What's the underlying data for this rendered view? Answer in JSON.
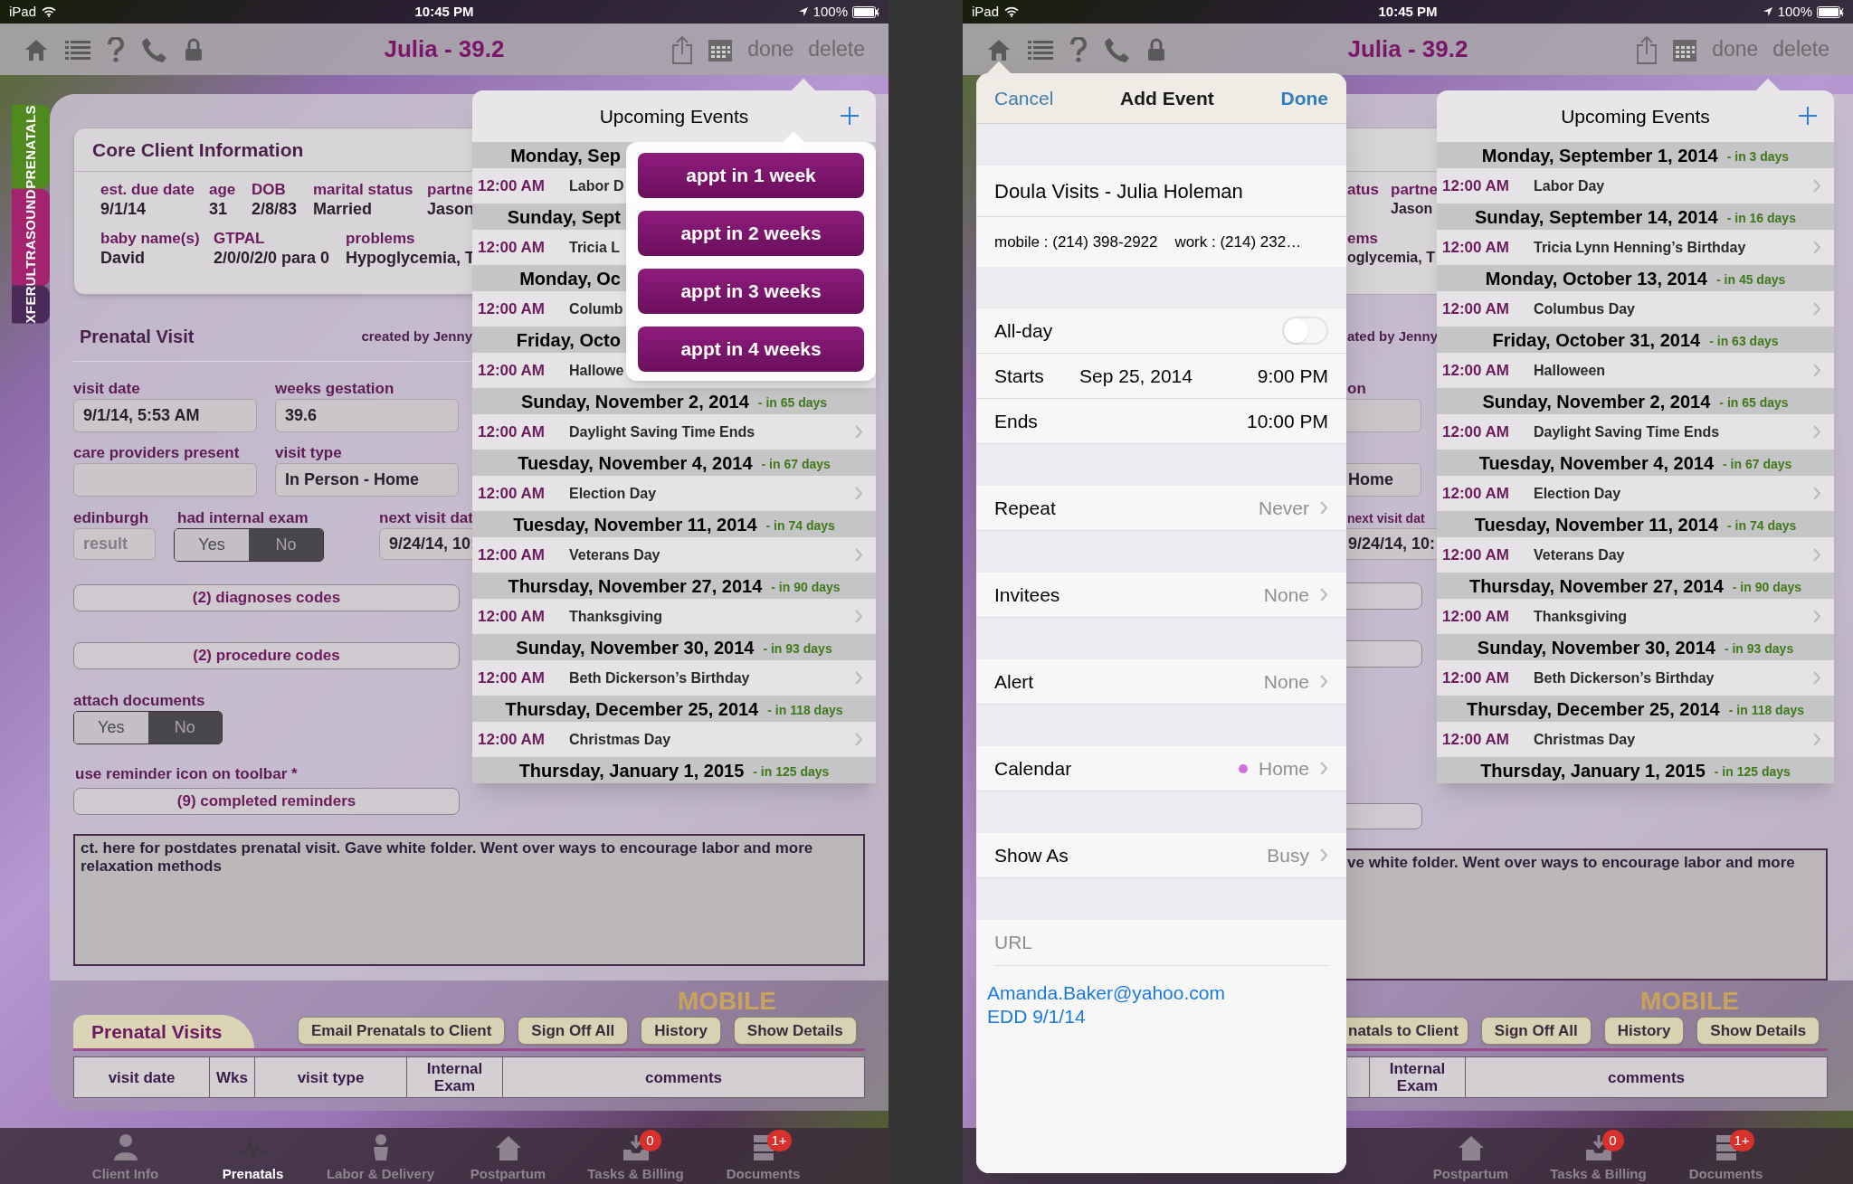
{
  "left_screen": {
    "status_bar": {
      "carrier": "iPad",
      "time": "10:45 PM",
      "battery": "100%"
    },
    "nav_bar": {
      "title": "Julia - 39.2",
      "actions": [
        "done",
        "delete"
      ]
    },
    "side_tabs": [
      {
        "label": "PRENATALS",
        "color": "#4f8a1f"
      },
      {
        "label": "ULTRASOUND",
        "color": "#a3236f"
      },
      {
        "label": "XFER",
        "color": "#4b2a5a"
      }
    ],
    "core_info": {
      "title": "Core Client Information",
      "rows": [
        {
          "fields": [
            {
              "label": "est. due date",
              "value": "9/1/14"
            },
            {
              "label": "age",
              "value": "31"
            },
            {
              "label": "DOB",
              "value": "2/8/83"
            },
            {
              "label": "marital status",
              "value": "Married"
            },
            {
              "label": "partne",
              "value": "Jason"
            }
          ]
        },
        {
          "fields": [
            {
              "label": "baby name(s)",
              "value": "David"
            },
            {
              "label": "GTPAL",
              "value": "2/0/0/2/0 para 0"
            },
            {
              "label": "problems",
              "value": "Hypoglycemia, T"
            }
          ]
        }
      ]
    },
    "prenatal_visit": {
      "title": "Prenatal Visit",
      "created_by": "created by Jenny",
      "visit_date": {
        "label": "visit date",
        "value": "9/1/14, 5:53 AM"
      },
      "weeks_gestation": {
        "label": "weeks gestation",
        "value": "39.6"
      },
      "care_providers": {
        "label": "care providers present"
      },
      "visit_type": {
        "label": "visit type",
        "value": "In Person - Home"
      },
      "edinburgh": {
        "label": "edinburgh",
        "placeholder": "result"
      },
      "internal_exam": {
        "label": "had internal exam",
        "options": [
          {
            "label": "Yes",
            "selected": false
          },
          {
            "label": "No",
            "selected": true
          }
        ]
      },
      "next_visit": {
        "label": "next visit dat",
        "value": "9/24/14, 10:"
      },
      "diagnoses_button": "(2) diagnoses codes",
      "procedure_button": "(2) procedure codes",
      "attach_documents": {
        "label": "attach documents",
        "options": [
          {
            "label": "Yes",
            "selected": false
          },
          {
            "label": "No",
            "selected": true
          }
        ]
      },
      "reminder_note": "use reminder icon on toolbar *",
      "reminders_button": "(9) completed reminders",
      "notes": "ct. here for postdates prenatal visit.  Gave white folder.  Went over ways to encourage labor and more relaxation methods"
    },
    "visits_section": {
      "logo_text": "MOBILE",
      "title": "Prenatal Visits",
      "buttons": [
        "Email Prenatals to Client",
        "Sign Off All",
        "History",
        "Show Details"
      ],
      "columns": [
        "visit date",
        "Wks",
        "visit type",
        "Internal Exam",
        "comments"
      ]
    },
    "upcoming_events": {
      "title": "Upcoming Events",
      "groups": [
        {
          "date": "Monday, Sep",
          "covered": true,
          "event": {
            "time": "12:00 AM",
            "name": "Labor D"
          }
        },
        {
          "date": "Sunday, Sept",
          "covered": true,
          "event": {
            "time": "12:00 AM",
            "name": "Tricia L"
          }
        },
        {
          "date": "Monday, Oc",
          "covered": true,
          "event": {
            "time": "12:00 AM",
            "name": "Columb"
          }
        },
        {
          "date": "Friday, Octo",
          "covered": true,
          "event": {
            "time": "12:00 AM",
            "name": "Hallowe"
          }
        },
        {
          "date": "Sunday, November 2, 2014",
          "relative": "- in 65 days",
          "covered": false,
          "event": {
            "time": "12:00 AM",
            "name": "Daylight Saving Time Ends"
          }
        },
        {
          "date": "Tuesday, November 4, 2014",
          "relative": "- in 67 days",
          "covered": false,
          "event": {
            "time": "12:00 AM",
            "name": "Election Day"
          }
        },
        {
          "date": "Tuesday, November 11, 2014",
          "relative": "- in 74 days",
          "covered": false,
          "event": {
            "time": "12:00 AM",
            "name": "Veterans Day"
          }
        },
        {
          "date": "Thursday, November 27, 2014",
          "relative": "- in 90 days",
          "covered": false,
          "event": {
            "time": "12:00 AM",
            "name": "Thanksgiving"
          }
        },
        {
          "date": "Sunday, November 30, 2014",
          "relative": "- in 93 days",
          "covered": false,
          "event": {
            "time": "12:00 AM",
            "name": "Beth Dickerson’s Birthday"
          }
        },
        {
          "date": "Thursday, December 25, 2014",
          "relative": "- in 118 days",
          "covered": false,
          "event": {
            "time": "12:00 AM",
            "name": "Christmas Day"
          }
        },
        {
          "date": "Thursday, January 1, 2015",
          "relative": "- in 125 days",
          "covered": false
        }
      ]
    },
    "quick_appointments": [
      "appt in 1 week",
      "appt in 2 weeks",
      "appt in 3 weeks",
      "appt in 4 weeks"
    ],
    "tab_bar": [
      {
        "label": "Client Info",
        "kind": "person",
        "selected": false
      },
      {
        "label": "Prenatals",
        "kind": "pulse",
        "selected": true
      },
      {
        "label": "Labor & Delivery",
        "kind": "baby",
        "selected": false
      },
      {
        "label": "Postpartum",
        "kind": "house",
        "selected": false
      },
      {
        "label": "Tasks & Billing",
        "kind": "inbox",
        "selected": false,
        "badge": "0"
      },
      {
        "label": "Documents",
        "kind": "cabinet",
        "selected": false,
        "badge": "1+"
      }
    ]
  },
  "right_screen": {
    "status_bar": {
      "carrier": "iPad",
      "time": "10:45 PM",
      "battery": "100%"
    },
    "nav_bar": {
      "title": "Julia - 39.2",
      "actions": [
        "done",
        "delete"
      ]
    },
    "core_info": {
      "rows": [
        {
          "fields": [
            {
              "label": "atus"
            },
            {
              "label": "partne",
              "value": "Jason"
            }
          ]
        },
        {
          "fields": [
            {
              "label": "ems",
              "value": "oglycemia, T"
            }
          ]
        }
      ]
    },
    "prenatal_visit": {
      "created_by": "ated by Jenny",
      "weeks_gestation": {
        "label": "on"
      },
      "visit_type": {
        "value": "Home"
      },
      "next_visit": {
        "label": "next visit dat",
        "value": "9/24/14, 10:"
      },
      "notes": "ve white folder.  Went over ways to encourage labor and more"
    },
    "visits_section": {
      "logo_text": "MOBILE",
      "buttons": [
        "natals to Client",
        "Sign Off All",
        "History",
        "Show Details"
      ],
      "columns": [
        "Internal Exam",
        "comments"
      ]
    },
    "upcoming_events": {
      "title": "Upcoming Events",
      "groups": [
        {
          "date": "Monday, September 1, 2014",
          "relative": "- in 3 days",
          "covered": false,
          "event": {
            "time": "12:00 AM",
            "name": "Labor Day"
          }
        },
        {
          "date": "Sunday, September 14, 2014",
          "relative": "- in 16 days",
          "covered": false,
          "event": {
            "time": "12:00 AM",
            "name": "Tricia Lynn Henning’s Birthday"
          }
        },
        {
          "date": "Monday, October 13, 2014",
          "relative": "- in 45 days",
          "covered": false,
          "event": {
            "time": "12:00 AM",
            "name": "Columbus Day"
          }
        },
        {
          "date": "Friday, October 31, 2014",
          "relative": "- in 63 days",
          "covered": false,
          "event": {
            "time": "12:00 AM",
            "name": "Halloween"
          }
        },
        {
          "date": "Sunday, November 2, 2014",
          "relative": "- in 65 days",
          "covered": false,
          "event": {
            "time": "12:00 AM",
            "name": "Daylight Saving Time Ends"
          }
        },
        {
          "date": "Tuesday, November 4, 2014",
          "relative": "- in 67 days",
          "covered": false,
          "event": {
            "time": "12:00 AM",
            "name": "Election Day"
          }
        },
        {
          "date": "Tuesday, November 11, 2014",
          "relative": "- in 74 days",
          "covered": false,
          "event": {
            "time": "12:00 AM",
            "name": "Veterans Day"
          }
        },
        {
          "date": "Thursday, November 27, 2014",
          "relative": "- in 90 days",
          "covered": false,
          "event": {
            "time": "12:00 AM",
            "name": "Thanksgiving"
          }
        },
        {
          "date": "Sunday, November 30, 2014",
          "relative": "- in 93 days",
          "covered": false,
          "event": {
            "time": "12:00 AM",
            "name": "Beth Dickerson’s Birthday"
          }
        },
        {
          "date": "Thursday, December 25, 2014",
          "relative": "- in 118 days",
          "covered": false,
          "event": {
            "time": "12:00 AM",
            "name": "Christmas Day"
          }
        },
        {
          "date": "Thursday, January 1, 2015",
          "relative": "- in 125 days",
          "covered": false
        }
      ]
    },
    "add_event": {
      "cancel": "Cancel",
      "title": "Add Event",
      "done": "Done",
      "event_title": "Doula Visits - Julia Holeman",
      "location": "mobile : (214) 398-2922    work : (214) 232…",
      "all_day": {
        "label": "All-day",
        "on": false
      },
      "starts": {
        "label": "Starts",
        "date": "Sep 25, 2014",
        "time": "9:00 PM"
      },
      "ends": {
        "label": "Ends",
        "time": "10:00 PM"
      },
      "options": [
        {
          "label": "Repeat",
          "value": "Never"
        },
        {
          "label": "Invitees",
          "value": "None"
        },
        {
          "label": "Alert",
          "value": "None"
        },
        {
          "label": "Calendar",
          "value": "Home",
          "color": "#d070e0"
        },
        {
          "label": "Show As",
          "value": "Busy"
        }
      ],
      "url": {
        "placeholder": "URL"
      },
      "notes": [
        "Amanda.Baker@yahoo.com",
        "EDD 9/1/14"
      ]
    },
    "tab_bar": [
      {
        "label": "Postpartum",
        "kind": "house",
        "selected": false
      },
      {
        "label": "Tasks & Billing",
        "kind": "inbox",
        "selected": false,
        "badge": "0"
      },
      {
        "label": "Documents",
        "kind": "cabinet",
        "selected": false,
        "badge": "1+"
      }
    ]
  }
}
